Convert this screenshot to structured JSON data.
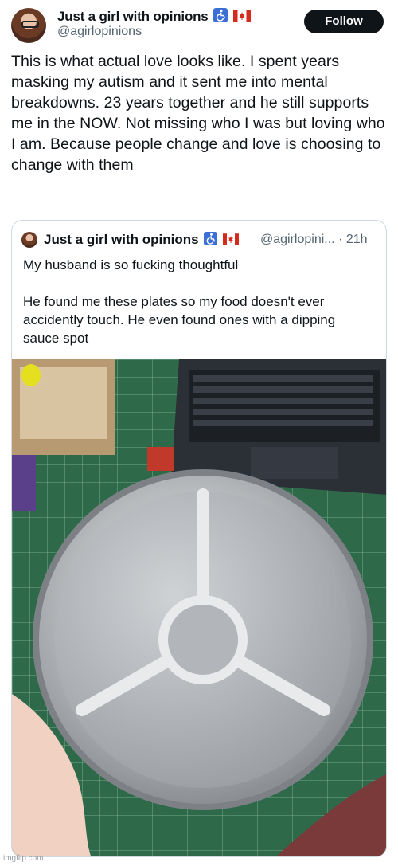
{
  "post": {
    "display_name": "Just a girl with opinions",
    "handle": "@agirlopinions",
    "follow_label": "Follow",
    "badges": [
      "wheelchair-icon",
      "canada-flag-icon"
    ],
    "text": "This is what actual love looks like. I spent years masking my autism and it sent me into mental breakdowns.  23 years together and he still supports me in the NOW. Not missing who I was but loving who I am. Because people change and love is choosing to change with them"
  },
  "quote": {
    "display_name": "Just a girl with opinions",
    "handle": "@agirlopini...",
    "separator": "·",
    "time": "21h",
    "paragraph1": "My husband is so fucking thoughtful",
    "paragraph2": "He found me these plates so my food doesn't ever accidently touch. He even found ones with a dipping sauce spot",
    "photo_icon": "divided-plate-photo"
  },
  "watermark": "imgflip.com",
  "colors": {
    "text": "#0f1419",
    "secondary": "#536471",
    "follow_bg": "#0f1419",
    "border": "#cfd9de",
    "cutting_mat": "#2e6a4a"
  }
}
